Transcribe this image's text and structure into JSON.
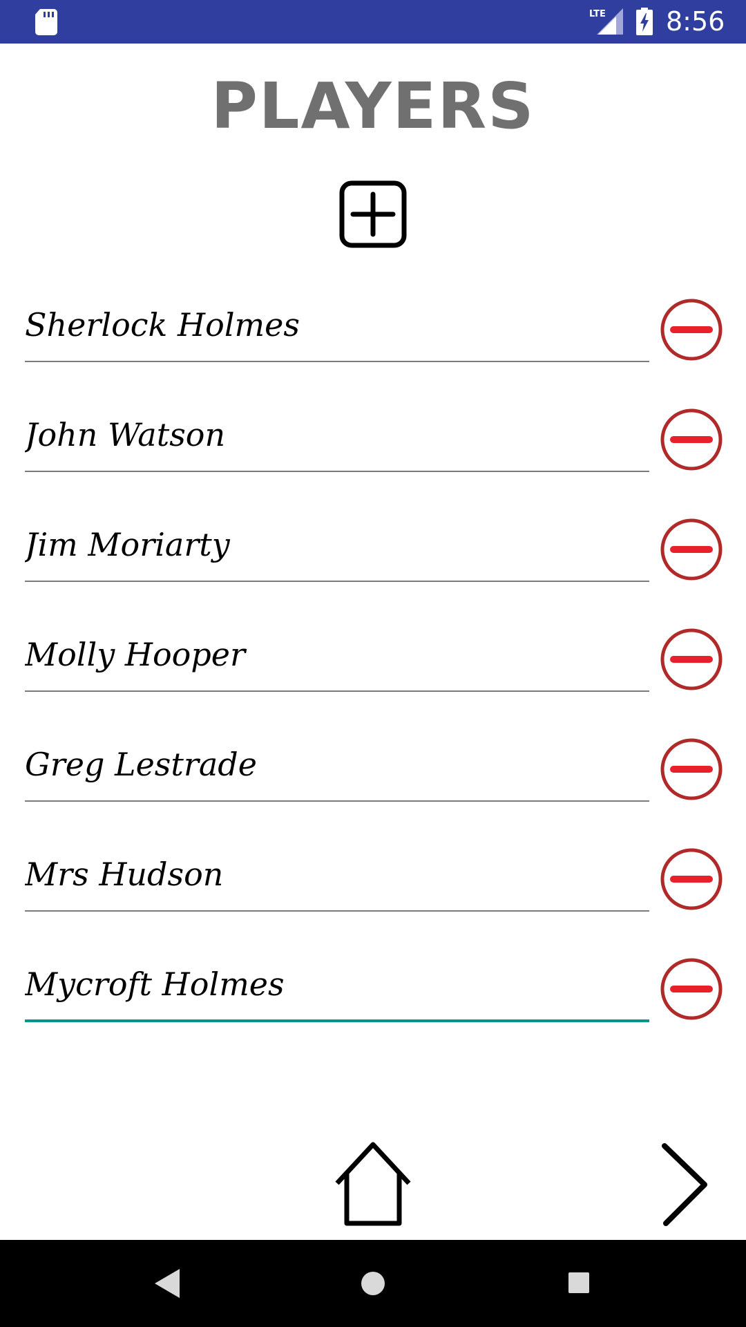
{
  "status_bar": {
    "time": "8:56",
    "network_label": "LTE",
    "icons": [
      "sd-card-icon",
      "lte-signal-icon",
      "battery-charging-icon"
    ],
    "background": "#303f9f"
  },
  "title": "PLAYERS",
  "add_button_icon": "add-square-icon",
  "players": [
    {
      "name": "Sherlock Holmes"
    },
    {
      "name": "John Watson"
    },
    {
      "name": "Jim Moriarty"
    },
    {
      "name": "Molly Hooper"
    },
    {
      "name": "Greg Lestrade"
    },
    {
      "name": "Mrs Hudson"
    },
    {
      "name": "Mycroft Holmes",
      "focused": true
    }
  ],
  "remove_button_icon": "remove-circle-icon",
  "colors": {
    "title": "#707070",
    "remove_ring": "#b02a2a",
    "remove_bar": "#e8202a",
    "focused_underline": "#009688",
    "underline": "#7a7a7a"
  },
  "bottom_nav": {
    "home_icon": "home-icon",
    "next_icon": "chevron-right-icon"
  },
  "system_nav": {
    "icons": [
      "back-triangle-icon",
      "home-circle-icon",
      "recents-square-icon"
    ]
  }
}
